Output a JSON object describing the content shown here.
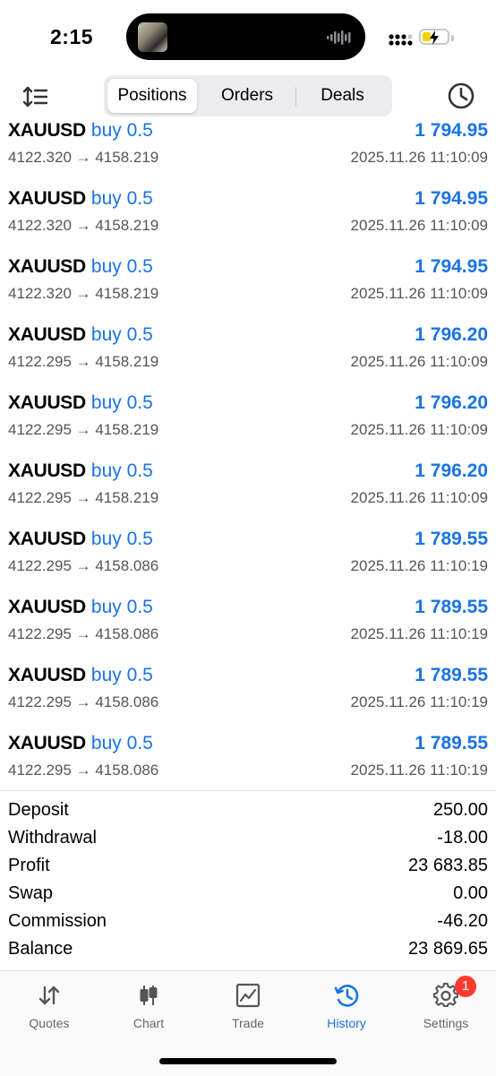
{
  "status_bar": {
    "time": "2:15"
  },
  "header": {
    "tabs": [
      {
        "label": "Positions",
        "active": true
      },
      {
        "label": "Orders",
        "active": false
      },
      {
        "label": "Deals",
        "active": false
      }
    ]
  },
  "deals": [
    {
      "symbol": "XAUUSD",
      "side": "buy 0.5",
      "profit": "1 794.95",
      "prices": "4122.320 → 4158.219",
      "time": "2025.11.26 11:10:09"
    },
    {
      "symbol": "XAUUSD",
      "side": "buy 0.5",
      "profit": "1 794.95",
      "prices": "4122.320 → 4158.219",
      "time": "2025.11.26 11:10:09"
    },
    {
      "symbol": "XAUUSD",
      "side": "buy 0.5",
      "profit": "1 794.95",
      "prices": "4122.320 → 4158.219",
      "time": "2025.11.26 11:10:09"
    },
    {
      "symbol": "XAUUSD",
      "side": "buy 0.5",
      "profit": "1 796.20",
      "prices": "4122.295 → 4158.219",
      "time": "2025.11.26 11:10:09"
    },
    {
      "symbol": "XAUUSD",
      "side": "buy 0.5",
      "profit": "1 796.20",
      "prices": "4122.295 → 4158.219",
      "time": "2025.11.26 11:10:09"
    },
    {
      "symbol": "XAUUSD",
      "side": "buy 0.5",
      "profit": "1 796.20",
      "prices": "4122.295 → 4158.219",
      "time": "2025.11.26 11:10:09"
    },
    {
      "symbol": "XAUUSD",
      "side": "buy 0.5",
      "profit": "1 789.55",
      "prices": "4122.295 → 4158.086",
      "time": "2025.11.26 11:10:19"
    },
    {
      "symbol": "XAUUSD",
      "side": "buy 0.5",
      "profit": "1 789.55",
      "prices": "4122.295 → 4158.086",
      "time": "2025.11.26 11:10:19"
    },
    {
      "symbol": "XAUUSD",
      "side": "buy 0.5",
      "profit": "1 789.55",
      "prices": "4122.295 → 4158.086",
      "time": "2025.11.26 11:10:19"
    },
    {
      "symbol": "XAUUSD",
      "side": "buy 0.5",
      "profit": "1 789.55",
      "prices": "4122.295 → 4158.086",
      "time": "2025.11.26 11:10:19"
    }
  ],
  "summary": [
    {
      "label": "Deposit",
      "value": "250.00"
    },
    {
      "label": "Withdrawal",
      "value": "-18.00"
    },
    {
      "label": "Profit",
      "value": "23 683.85"
    },
    {
      "label": "Swap",
      "value": "0.00"
    },
    {
      "label": "Commission",
      "value": "-46.20"
    },
    {
      "label": "Balance",
      "value": "23 869.65"
    }
  ],
  "tab_bar": {
    "items": [
      {
        "label": "Quotes",
        "icon": "quotes-icon"
      },
      {
        "label": "Chart",
        "icon": "chart-icon"
      },
      {
        "label": "Trade",
        "icon": "trade-icon"
      },
      {
        "label": "History",
        "icon": "history-icon",
        "active": true
      },
      {
        "label": "Settings",
        "icon": "gear-icon"
      }
    ],
    "settings_badge": "1"
  },
  "colors": {
    "accent": "#1a73e8",
    "badge": "#ff3b30",
    "battery": "#f5d400"
  }
}
